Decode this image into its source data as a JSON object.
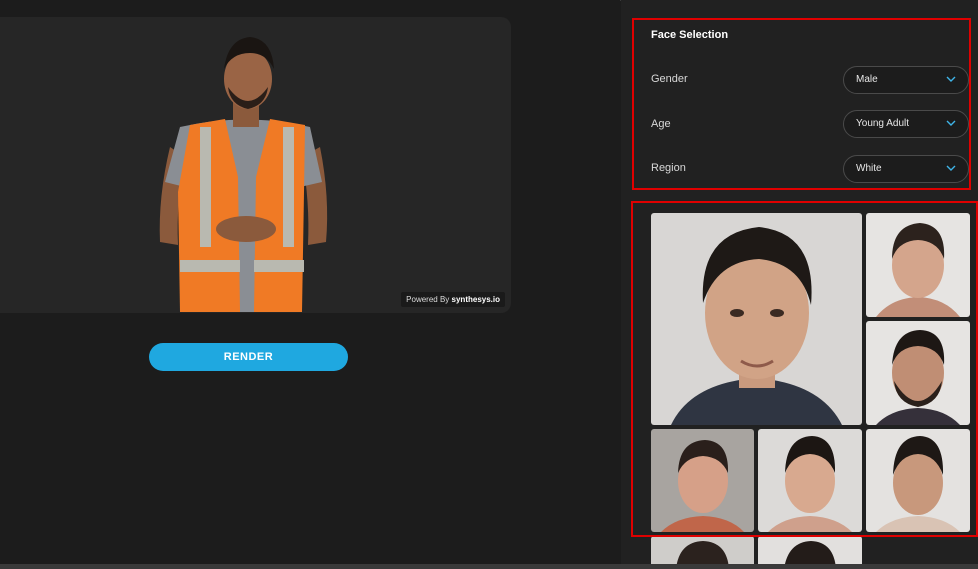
{
  "preview": {
    "powered_prefix": "Powered By ",
    "powered_brand": "synthesys.io"
  },
  "render_button": {
    "label": "RENDER"
  },
  "face_selection": {
    "title": "Face Selection",
    "fields": [
      {
        "label": "Gender",
        "value": "Male"
      },
      {
        "label": "Age",
        "value": "Young Adult"
      },
      {
        "label": "Region",
        "value": "White"
      }
    ]
  },
  "colors": {
    "accent": "#1fa8e0",
    "highlight_border": "#e00000",
    "vest_orange": "#f07a25",
    "background": "#1c1c1c"
  },
  "face_grid": {
    "items": [
      "face-large",
      "face-2",
      "face-3",
      "face-4",
      "face-5",
      "face-6",
      "face-7",
      "face-8"
    ]
  }
}
